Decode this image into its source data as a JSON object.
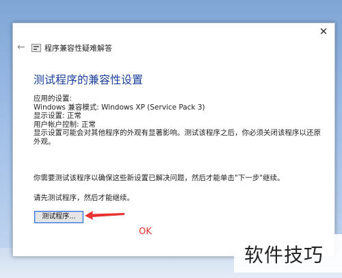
{
  "window": {
    "close_glyph": "✕",
    "back_glyph": "←",
    "title": "程序兼容性疑难解答"
  },
  "main": {
    "heading": "测试程序的兼容性设置",
    "settings": [
      "应用的设置:",
      "Windows 兼容模式: Windows XP (Service Pack 3)",
      "显示设置: 正常",
      "用户帐户控制: 正常",
      "显示设置可能会对其他程序的外观有显著影响。测试该程序之后，你必须关闭该程序以还原外观。"
    ],
    "instruction_next": "你需要测试该程序以确保这些新设置已解决问题，然后才能单击\"下一步\"继续。",
    "instruction_test_first": "请先测试程序，然后才能继续。",
    "test_button_label": "测试程序..."
  },
  "annotation": {
    "label": "OK",
    "color": "#e8322f"
  },
  "watermark": {
    "text": "软件技巧"
  },
  "colors": {
    "heading": "#1b3f9b",
    "button_border": "#2f6fd0"
  }
}
